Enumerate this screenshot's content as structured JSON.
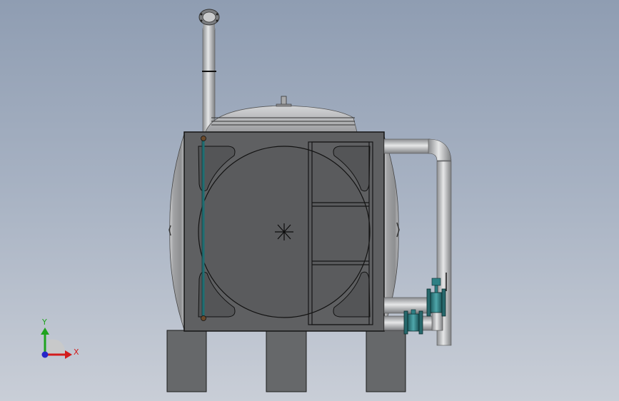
{
  "viewport": {
    "background_top": "#8f9db2",
    "background_bottom": "#c9ced7"
  },
  "model": {
    "tank_color": "#5f6062",
    "tank_shell_color": "#a2a3a5",
    "pipe_color": "#b4b6b9",
    "valve_color": "#2e7f84",
    "level_gauge_color": "#1e6e72",
    "base_support_color": "#66686a"
  },
  "triad": {
    "x_label": "X",
    "y_label": "Y",
    "x_color": "#d21c1c",
    "y_color": "#1fa31f",
    "z_color": "#2626c8"
  }
}
